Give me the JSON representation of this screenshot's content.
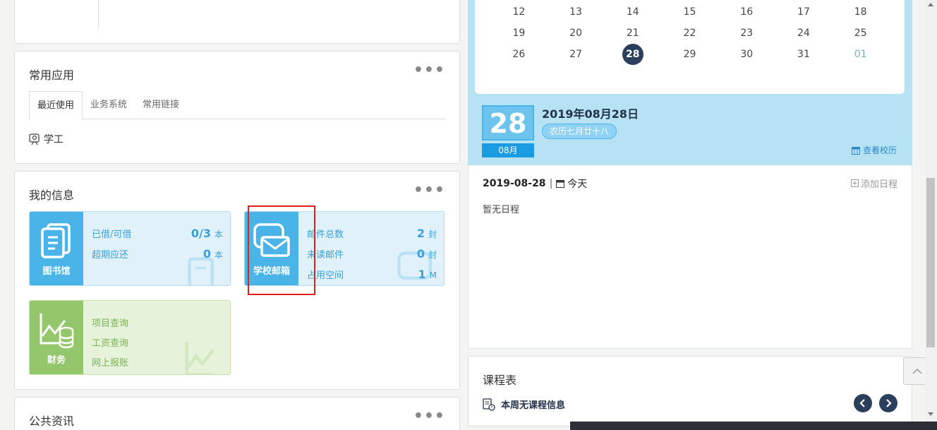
{
  "cards": {
    "common_apps": {
      "title": "常用应用",
      "tabs": [
        "最近使用",
        "业务系统",
        "常用链接"
      ],
      "items": [
        "学工"
      ]
    },
    "my_info": {
      "title": "我的信息",
      "library": {
        "label": "图书馆",
        "rows": [
          {
            "name": "已借/可借",
            "value": "0/3",
            "unit": "本"
          },
          {
            "name": "超期应还",
            "value": "0",
            "unit": "本"
          }
        ]
      },
      "mail": {
        "label": "学校邮箱",
        "rows": [
          {
            "name": "邮件总数",
            "value": "2",
            "unit": "封"
          },
          {
            "name": "未读邮件",
            "value": "0",
            "unit": "封"
          },
          {
            "name": "占用空间",
            "value": "1",
            "unit": "M"
          }
        ]
      },
      "finance": {
        "label": "财务",
        "rows": [
          "项目查询",
          "工资查询",
          "网上报账"
        ]
      }
    },
    "news": {
      "title": "公共资讯"
    }
  },
  "calendar": {
    "weeks": [
      [
        "12",
        "13",
        "14",
        "15",
        "16",
        "17",
        "18"
      ],
      [
        "19",
        "20",
        "21",
        "22",
        "23",
        "24",
        "25"
      ],
      [
        "26",
        "27",
        "28",
        "29",
        "30",
        "31",
        "01"
      ]
    ],
    "today": "28",
    "big_day": "28",
    "month_label": "08月",
    "date_title": "2019年08月28日",
    "lunar": "农历七月廿十八",
    "view_calendar": "查看校历"
  },
  "schedule": {
    "date": "2019-08-28",
    "sep": "|",
    "today_label": "今天",
    "add_label": "添加日程",
    "empty": "暂无日程"
  },
  "timetable": {
    "title": "课程表",
    "empty": "本周无课程信息"
  },
  "colors": {
    "accent_blue": "#4ab3e8",
    "finance_green": "#94c66c",
    "today_circle": "#2b3f5c",
    "highlight_box": "#e02020"
  }
}
